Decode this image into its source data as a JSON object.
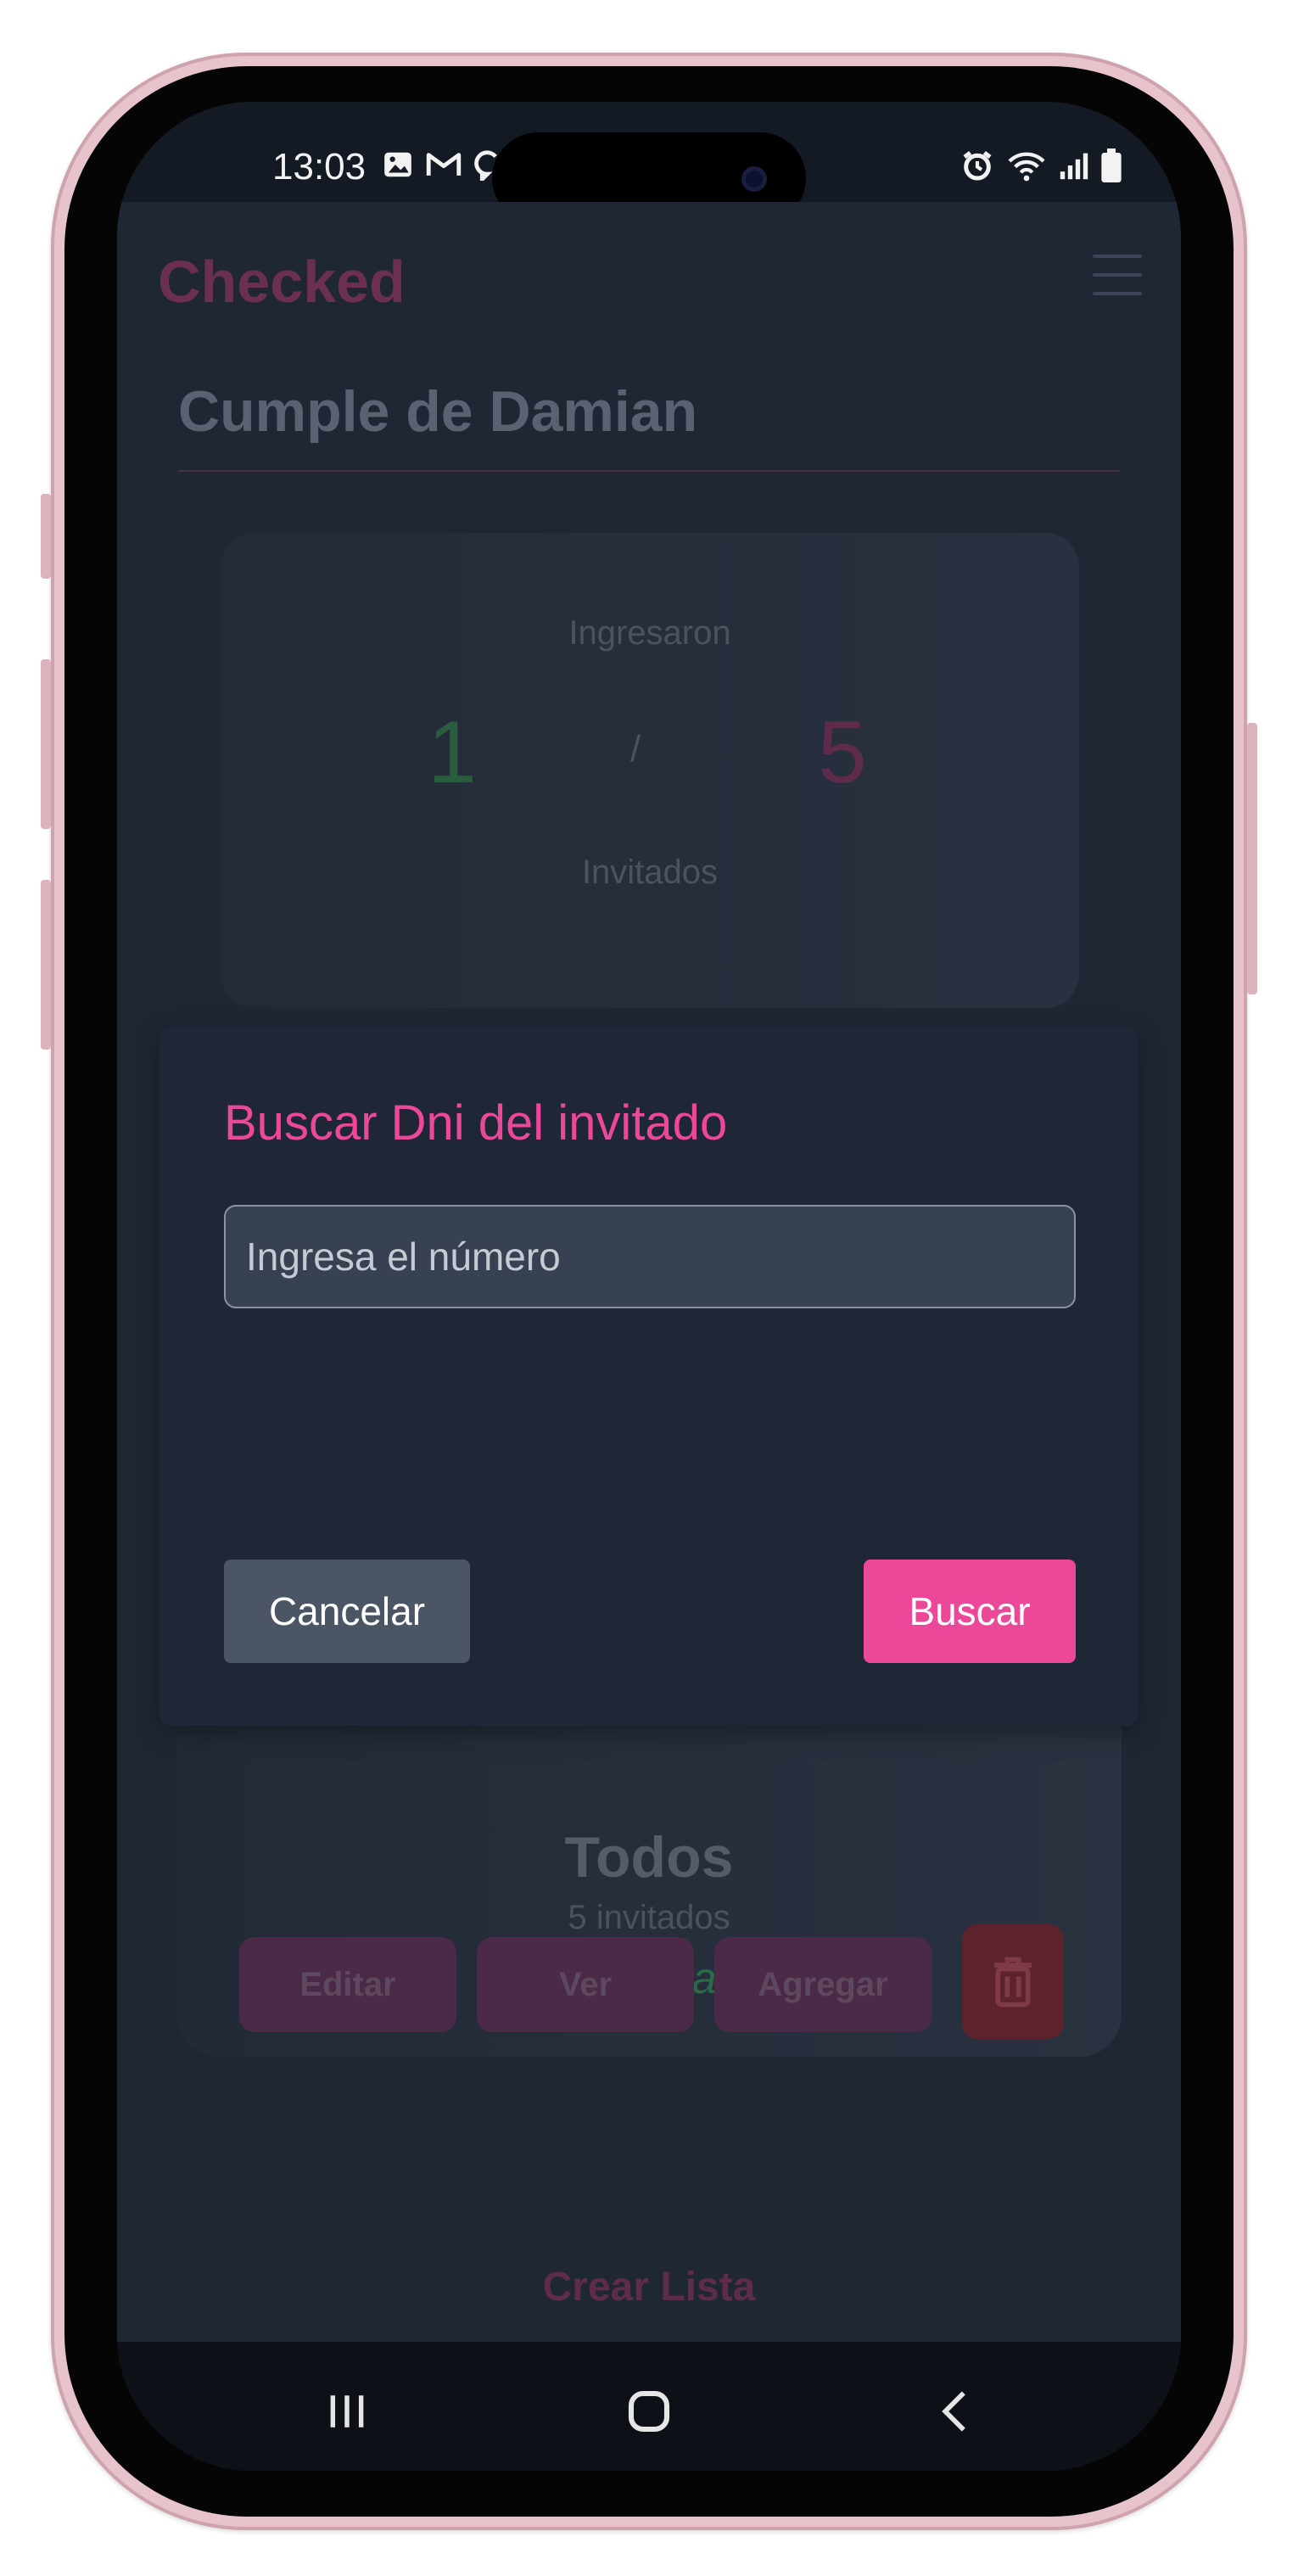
{
  "status_bar": {
    "time": "13:03",
    "left_icons": [
      "image-icon",
      "gmail-icon",
      "chat-icon"
    ],
    "right_icons": [
      "alarm-icon",
      "wifi-icon",
      "signal-icon",
      "battery-icon"
    ]
  },
  "app": {
    "brand": "Checked",
    "event_title": "Cumple de Damian"
  },
  "stats": {
    "entered_label": "Ingresaron",
    "entered_count": "1",
    "separator": "/",
    "invited_count": "5",
    "invited_label": "Invitados"
  },
  "list_card": {
    "title": "Todos",
    "count": "5 invitados",
    "state": "abierta",
    "buttons": {
      "edit": "Editar",
      "view": "Ver",
      "add": "Agregar"
    }
  },
  "create_list": "Crear Lista",
  "modal": {
    "title": "Buscar Dni del invitado",
    "input_placeholder": "Ingresa el número",
    "input_value": "",
    "cancel": "Cancelar",
    "search": "Buscar"
  },
  "colors": {
    "accent": "#ec4899",
    "success": "#2f7d52",
    "background": "#1f2735",
    "danger": "#5c232d"
  }
}
